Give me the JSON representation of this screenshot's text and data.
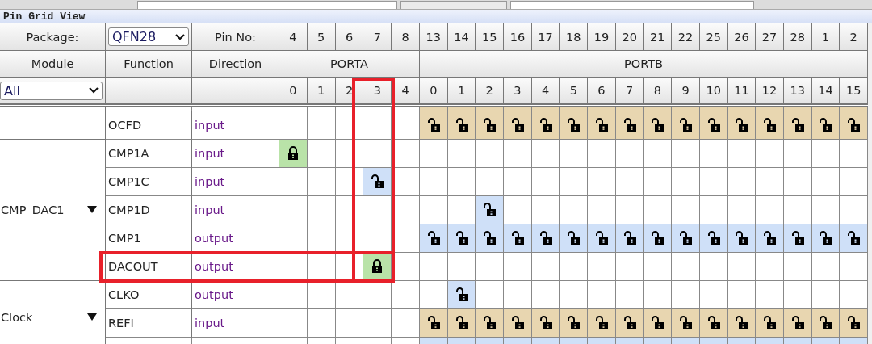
{
  "window": {
    "title": "Pin Grid View"
  },
  "package": {
    "label": "Package:",
    "value": "QFN28"
  },
  "pin_no_label": "Pin No:",
  "pin_numbers": [
    "4",
    "5",
    "6",
    "7",
    "8",
    "13",
    "14",
    "15",
    "16",
    "17",
    "18",
    "19",
    "20",
    "21",
    "22",
    "25",
    "26",
    "27",
    "28",
    "1",
    "2"
  ],
  "columns": {
    "module": "Module",
    "function": "Function",
    "direction": "Direction"
  },
  "module_filter": {
    "value": "All"
  },
  "ports": [
    {
      "name": "PORTA",
      "bits": [
        {
          "label": "0",
          "highlighted": false
        },
        {
          "label": "1",
          "highlighted": false
        },
        {
          "label": "2",
          "highlighted": false
        },
        {
          "label": "3",
          "highlighted": true
        },
        {
          "label": "4",
          "highlighted": false
        }
      ]
    },
    {
      "name": "PORTB",
      "bits": [
        {
          "label": "0",
          "highlighted": false
        },
        {
          "label": "1",
          "highlighted": false
        },
        {
          "label": "2",
          "highlighted": false
        },
        {
          "label": "3",
          "highlighted": false
        },
        {
          "label": "4",
          "highlighted": false
        },
        {
          "label": "5",
          "highlighted": false
        },
        {
          "label": "6",
          "highlighted": false
        },
        {
          "label": "7",
          "highlighted": false
        },
        {
          "label": "8",
          "highlighted": false
        },
        {
          "label": "9",
          "highlighted": false
        },
        {
          "label": "10",
          "highlighted": false
        },
        {
          "label": "11",
          "highlighted": false
        },
        {
          "label": "12",
          "highlighted": false
        },
        {
          "label": "13",
          "highlighted": false
        },
        {
          "label": "14",
          "highlighted": false
        },
        {
          "label": "15",
          "highlighted": false
        }
      ]
    }
  ],
  "groups": [
    {
      "rows": [
        {
          "pins": [
            {
              "kind": "empty"
            },
            {
              "kind": "empty"
            },
            {
              "kind": "empty"
            },
            {
              "kind": "empty"
            },
            {
              "kind": "empty"
            },
            {
              "kind": "reserved"
            },
            {
              "kind": "reserved"
            },
            {
              "kind": "reserved"
            },
            {
              "kind": "reserved"
            },
            {
              "kind": "reserved"
            },
            {
              "kind": "reserved"
            },
            {
              "kind": "reserved"
            },
            {
              "kind": "reserved"
            },
            {
              "kind": "reserved"
            },
            {
              "kind": "reserved"
            },
            {
              "kind": "reserved"
            },
            {
              "kind": "reserved"
            },
            {
              "kind": "reserved"
            },
            {
              "kind": "reserved"
            },
            {
              "kind": "reserved"
            },
            {
              "kind": "reserved"
            }
          ]
        },
        {
          "function": "OCFD",
          "direction": "input",
          "highlighted": false,
          "pins": [
            {
              "kind": "empty"
            },
            {
              "kind": "empty"
            },
            {
              "kind": "empty"
            },
            {
              "kind": "empty"
            },
            {
              "kind": "empty"
            },
            {
              "kind": "reserved"
            },
            {
              "kind": "reserved"
            },
            {
              "kind": "reserved"
            },
            {
              "kind": "reserved"
            },
            {
              "kind": "reserved"
            },
            {
              "kind": "reserved"
            },
            {
              "kind": "reserved"
            },
            {
              "kind": "reserved"
            },
            {
              "kind": "reserved"
            },
            {
              "kind": "reserved"
            },
            {
              "kind": "reserved"
            },
            {
              "kind": "reserved"
            },
            {
              "kind": "reserved"
            },
            {
              "kind": "reserved"
            },
            {
              "kind": "reserved"
            },
            {
              "kind": "reserved"
            }
          ]
        }
      ]
    },
    {
      "module": "CMP_DAC1",
      "expanded": true,
      "rows": [
        {
          "function": "CMP1A",
          "direction": "input",
          "highlighted": false,
          "pins": [
            {
              "kind": "locked"
            },
            {
              "kind": "empty"
            },
            {
              "kind": "empty"
            },
            {
              "kind": "empty"
            },
            {
              "kind": "empty"
            },
            {
              "kind": "empty"
            },
            {
              "kind": "empty"
            },
            {
              "kind": "empty"
            },
            {
              "kind": "empty"
            },
            {
              "kind": "empty"
            },
            {
              "kind": "empty"
            },
            {
              "kind": "empty"
            },
            {
              "kind": "empty"
            },
            {
              "kind": "empty"
            },
            {
              "kind": "empty"
            },
            {
              "kind": "empty"
            },
            {
              "kind": "empty"
            },
            {
              "kind": "empty"
            },
            {
              "kind": "empty"
            },
            {
              "kind": "empty"
            },
            {
              "kind": "empty"
            }
          ]
        },
        {
          "function": "CMP1C",
          "direction": "input",
          "highlighted": false,
          "pins": [
            {
              "kind": "empty"
            },
            {
              "kind": "empty"
            },
            {
              "kind": "empty"
            },
            {
              "kind": "available"
            },
            {
              "kind": "empty"
            },
            {
              "kind": "empty"
            },
            {
              "kind": "empty"
            },
            {
              "kind": "empty"
            },
            {
              "kind": "empty"
            },
            {
              "kind": "empty"
            },
            {
              "kind": "empty"
            },
            {
              "kind": "empty"
            },
            {
              "kind": "empty"
            },
            {
              "kind": "empty"
            },
            {
              "kind": "empty"
            },
            {
              "kind": "empty"
            },
            {
              "kind": "empty"
            },
            {
              "kind": "empty"
            },
            {
              "kind": "empty"
            },
            {
              "kind": "empty"
            },
            {
              "kind": "empty"
            }
          ]
        },
        {
          "function": "CMP1D",
          "direction": "input",
          "highlighted": false,
          "pins": [
            {
              "kind": "empty"
            },
            {
              "kind": "empty"
            },
            {
              "kind": "empty"
            },
            {
              "kind": "empty"
            },
            {
              "kind": "empty"
            },
            {
              "kind": "empty"
            },
            {
              "kind": "empty"
            },
            {
              "kind": "available"
            },
            {
              "kind": "empty"
            },
            {
              "kind": "empty"
            },
            {
              "kind": "empty"
            },
            {
              "kind": "empty"
            },
            {
              "kind": "empty"
            },
            {
              "kind": "empty"
            },
            {
              "kind": "empty"
            },
            {
              "kind": "empty"
            },
            {
              "kind": "empty"
            },
            {
              "kind": "empty"
            },
            {
              "kind": "empty"
            },
            {
              "kind": "empty"
            },
            {
              "kind": "empty"
            }
          ]
        },
        {
          "function": "CMP1",
          "direction": "output",
          "highlighted": false,
          "pins": [
            {
              "kind": "empty"
            },
            {
              "kind": "empty"
            },
            {
              "kind": "empty"
            },
            {
              "kind": "empty"
            },
            {
              "kind": "empty"
            },
            {
              "kind": "available"
            },
            {
              "kind": "available"
            },
            {
              "kind": "available"
            },
            {
              "kind": "available"
            },
            {
              "kind": "available"
            },
            {
              "kind": "available"
            },
            {
              "kind": "available"
            },
            {
              "kind": "available"
            },
            {
              "kind": "available"
            },
            {
              "kind": "available"
            },
            {
              "kind": "available"
            },
            {
              "kind": "available"
            },
            {
              "kind": "available"
            },
            {
              "kind": "available"
            },
            {
              "kind": "available"
            },
            {
              "kind": "available"
            }
          ]
        },
        {
          "function": "DACOUT",
          "direction": "output",
          "highlighted": true,
          "pins": [
            {
              "kind": "empty"
            },
            {
              "kind": "empty"
            },
            {
              "kind": "empty"
            },
            {
              "kind": "locked"
            },
            {
              "kind": "empty"
            },
            {
              "kind": "empty"
            },
            {
              "kind": "empty"
            },
            {
              "kind": "empty"
            },
            {
              "kind": "empty"
            },
            {
              "kind": "empty"
            },
            {
              "kind": "empty"
            },
            {
              "kind": "empty"
            },
            {
              "kind": "empty"
            },
            {
              "kind": "empty"
            },
            {
              "kind": "empty"
            },
            {
              "kind": "empty"
            },
            {
              "kind": "empty"
            },
            {
              "kind": "empty"
            },
            {
              "kind": "empty"
            },
            {
              "kind": "empty"
            },
            {
              "kind": "empty"
            }
          ]
        }
      ]
    },
    {
      "module": "Clock",
      "expanded": true,
      "rows": [
        {
          "function": "CLKO",
          "direction": "output",
          "highlighted": false,
          "pins": [
            {
              "kind": "empty"
            },
            {
              "kind": "empty"
            },
            {
              "kind": "empty"
            },
            {
              "kind": "empty"
            },
            {
              "kind": "empty"
            },
            {
              "kind": "empty"
            },
            {
              "kind": "available"
            },
            {
              "kind": "empty"
            },
            {
              "kind": "empty"
            },
            {
              "kind": "empty"
            },
            {
              "kind": "empty"
            },
            {
              "kind": "empty"
            },
            {
              "kind": "empty"
            },
            {
              "kind": "empty"
            },
            {
              "kind": "empty"
            },
            {
              "kind": "empty"
            },
            {
              "kind": "empty"
            },
            {
              "kind": "empty"
            },
            {
              "kind": "empty"
            },
            {
              "kind": "empty"
            },
            {
              "kind": "empty"
            }
          ]
        },
        {
          "function": "REFI",
          "direction": "input",
          "highlighted": false,
          "pins": [
            {
              "kind": "empty"
            },
            {
              "kind": "empty"
            },
            {
              "kind": "empty"
            },
            {
              "kind": "empty"
            },
            {
              "kind": "empty"
            },
            {
              "kind": "reserved"
            },
            {
              "kind": "reserved"
            },
            {
              "kind": "reserved"
            },
            {
              "kind": "reserved"
            },
            {
              "kind": "reserved"
            },
            {
              "kind": "reserved"
            },
            {
              "kind": "reserved"
            },
            {
              "kind": "reserved"
            },
            {
              "kind": "reserved"
            },
            {
              "kind": "reserved"
            },
            {
              "kind": "reserved"
            },
            {
              "kind": "reserved"
            },
            {
              "kind": "reserved"
            },
            {
              "kind": "reserved"
            },
            {
              "kind": "reserved"
            },
            {
              "kind": "reserved"
            }
          ]
        },
        {
          "pins": [
            {
              "kind": "empty"
            },
            {
              "kind": "empty"
            },
            {
              "kind": "empty"
            },
            {
              "kind": "empty"
            },
            {
              "kind": "empty"
            },
            {
              "kind": "available"
            },
            {
              "kind": "available"
            },
            {
              "kind": "available"
            },
            {
              "kind": "available"
            },
            {
              "kind": "available"
            },
            {
              "kind": "available"
            },
            {
              "kind": "available"
            },
            {
              "kind": "available"
            },
            {
              "kind": "available"
            },
            {
              "kind": "available"
            },
            {
              "kind": "available"
            },
            {
              "kind": "available"
            },
            {
              "kind": "available"
            },
            {
              "kind": "available"
            },
            {
              "kind": "available"
            },
            {
              "kind": "available"
            }
          ]
        }
      ]
    }
  ]
}
